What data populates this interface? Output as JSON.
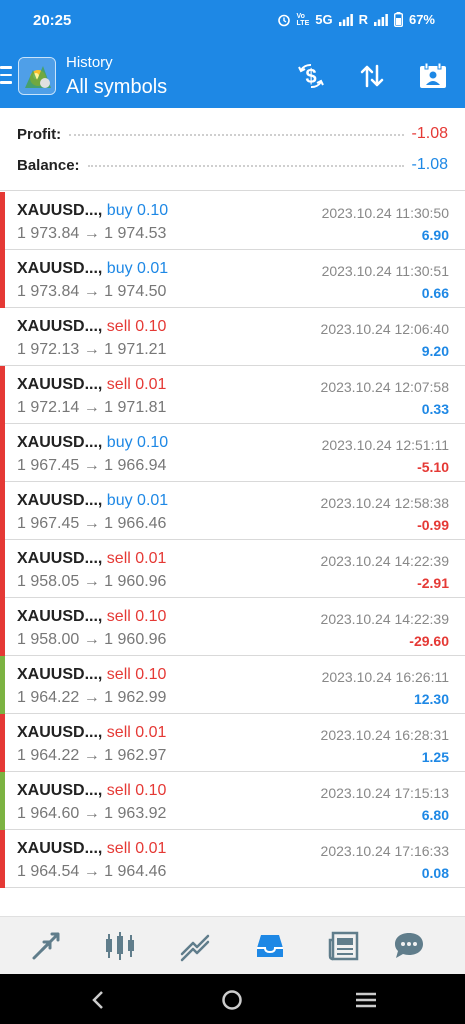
{
  "status_bar": {
    "time": "20:25",
    "network": "5G",
    "roaming": "R",
    "battery": "67%"
  },
  "app_bar": {
    "title": "History",
    "subtitle": "All symbols"
  },
  "summary": {
    "profit_label": "Profit:",
    "profit_value": "-1.08",
    "balance_label": "Balance:",
    "balance_value": "-1.08"
  },
  "deals": [
    {
      "symbol": "XAUUSD...,",
      "action": "buy 0.10",
      "type": "buy",
      "prices": "1 973.84 → 1 974.53",
      "time": "2023.10.24 11:30:50",
      "profit": "6.90",
      "bar": "#e53935"
    },
    {
      "symbol": "XAUUSD...,",
      "action": "buy 0.01",
      "type": "buy",
      "prices": "1 973.84 → 1 974.50",
      "time": "2023.10.24 11:30:51",
      "profit": "0.66",
      "bar": "#e53935"
    },
    {
      "symbol": "XAUUSD...,",
      "action": "sell 0.10",
      "type": "sell",
      "prices": "1 972.13 → 1 971.21",
      "time": "2023.10.24 12:06:40",
      "profit": "9.20",
      "bar": ""
    },
    {
      "symbol": "XAUUSD...,",
      "action": "sell 0.01",
      "type": "sell",
      "prices": "1 972.14 → 1 971.81",
      "time": "2023.10.24 12:07:58",
      "profit": "0.33",
      "bar": "#e53935"
    },
    {
      "symbol": "XAUUSD...,",
      "action": "buy 0.10",
      "type": "buy",
      "prices": "1 967.45 → 1 966.94",
      "time": "2023.10.24 12:51:11",
      "profit": "-5.10",
      "bar": "#e53935"
    },
    {
      "symbol": "XAUUSD...,",
      "action": "buy 0.01",
      "type": "buy",
      "prices": "1 967.45 → 1 966.46",
      "time": "2023.10.24 12:58:38",
      "profit": "-0.99",
      "bar": "#e53935"
    },
    {
      "symbol": "XAUUSD...,",
      "action": "sell 0.01",
      "type": "sell",
      "prices": "1 958.05 → 1 960.96",
      "time": "2023.10.24 14:22:39",
      "profit": "-2.91",
      "bar": "#e53935"
    },
    {
      "symbol": "XAUUSD...,",
      "action": "sell 0.10",
      "type": "sell",
      "prices": "1 958.00 → 1 960.96",
      "time": "2023.10.24 14:22:39",
      "profit": "-29.60",
      "bar": "#e53935"
    },
    {
      "symbol": "XAUUSD...,",
      "action": "sell 0.10",
      "type": "sell",
      "prices": "1 964.22 → 1 962.99",
      "time": "2023.10.24 16:26:11",
      "profit": "12.30",
      "bar": "#7cb342"
    },
    {
      "symbol": "XAUUSD...,",
      "action": "sell 0.01",
      "type": "sell",
      "prices": "1 964.22 → 1 962.97",
      "time": "2023.10.24 16:28:31",
      "profit": "1.25",
      "bar": "#e53935"
    },
    {
      "symbol": "XAUUSD...,",
      "action": "sell 0.10",
      "type": "sell",
      "prices": "1 964.60 → 1 963.92",
      "time": "2023.10.24 17:15:13",
      "profit": "6.80",
      "bar": "#7cb342"
    },
    {
      "symbol": "XAUUSD...,",
      "action": "sell 0.01",
      "type": "sell",
      "prices": "1 964.54 → 1 964.46",
      "time": "2023.10.24 17:16:33",
      "profit": "0.08",
      "bar": "#e53935"
    }
  ],
  "bottom_nav": {
    "items": [
      "quotes-icon",
      "chart-icon",
      "trade-icon",
      "history-icon",
      "news-icon",
      "messages-icon"
    ],
    "active": "history-icon"
  },
  "colors": {
    "accent": "#1e88e5",
    "buy": "#1e88e5",
    "sell": "#e53935",
    "loss_bar": "#e53935",
    "gain_bar": "#7cb342"
  }
}
